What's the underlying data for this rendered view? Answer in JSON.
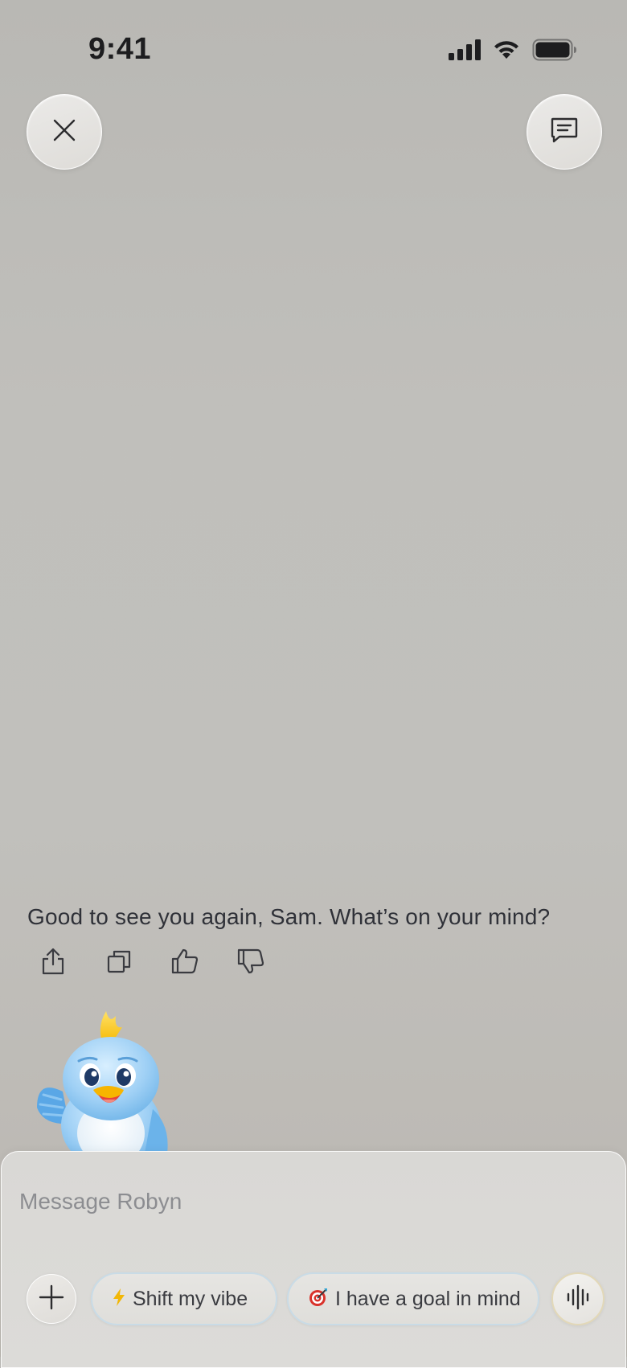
{
  "status": {
    "time": "9:41"
  },
  "header": {
    "close_icon": "close-icon",
    "chat_icon": "chat-bubble-icon"
  },
  "message": {
    "text": "Good to see you again, Sam. What’s on your mind?",
    "actions": [
      "share-icon",
      "copy-icon",
      "thumbs-up-icon",
      "thumbs-down-icon"
    ]
  },
  "composer": {
    "placeholder": "Message Robyn",
    "value": "",
    "chips": [
      {
        "icon": "⚡",
        "label": "Shift my vibe"
      },
      {
        "icon": "🎯",
        "label": "I have a goal in mind"
      }
    ]
  },
  "colors": {
    "text": "#2f3138",
    "placeholder": "#8c8d91",
    "chip_border": "#c9dbe6",
    "lightning": "#f2b705"
  }
}
